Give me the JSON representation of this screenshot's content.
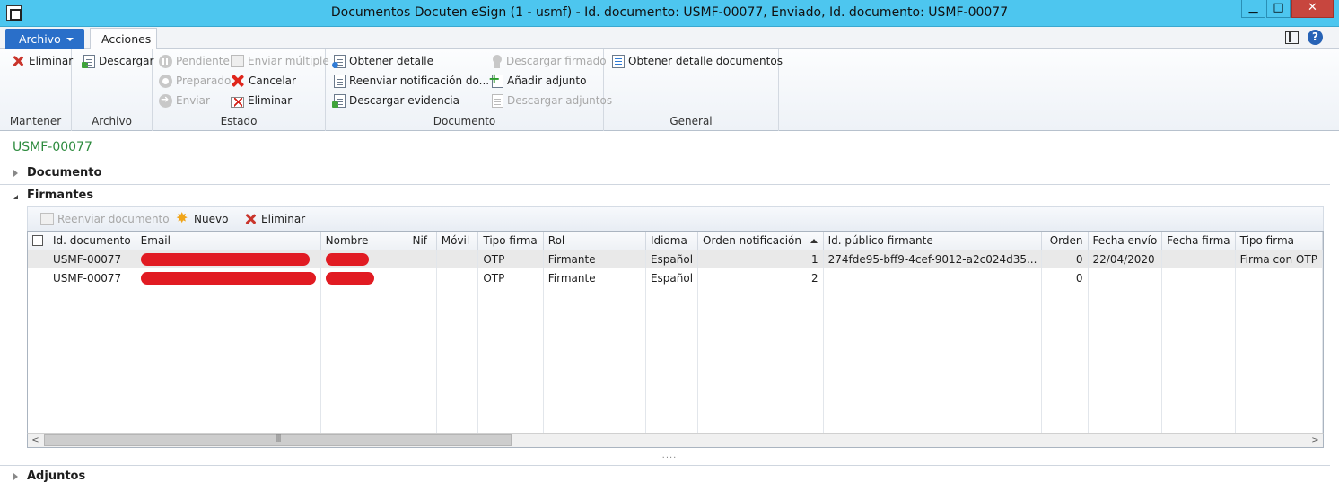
{
  "window": {
    "title": "Documentos Docuten eSign (1 - usmf) - Id. documento: USMF-00077, Enviado, Id. documento: USMF-00077",
    "minimize_glyph": "▁",
    "maximize_glyph": "□",
    "close_glyph": "✕"
  },
  "ribbon_tabs": {
    "archivo": "Archivo",
    "acciones": "Acciones",
    "help_glyph": "?"
  },
  "ribbon": {
    "mantener": {
      "label": "Mantener",
      "eliminar": "Eliminar"
    },
    "archivo": {
      "label": "Archivo",
      "descargar": "Descargar"
    },
    "estado": {
      "label": "Estado",
      "pendiente": "Pendiente",
      "preparado": "Preparado",
      "enviar": "Enviar",
      "enviar_multiple": "Enviar múltiple",
      "cancelar": "Cancelar",
      "eliminar": "Eliminar"
    },
    "documento": {
      "label": "Documento",
      "obtener_detalle": "Obtener detalle",
      "reenviar_notificacion": "Reenviar notificación do...",
      "descargar_evidencia": "Descargar evidencia",
      "descargar_firmado": "Descargar firmado",
      "anadir_adjunto": "Añadir adjunto",
      "descargar_adjuntos": "Descargar adjuntos"
    },
    "general": {
      "label": "General",
      "obtener_detalle_documentos": "Obtener detalle documentos"
    }
  },
  "record": {
    "title": "USMF-00077"
  },
  "fasttabs": {
    "documento": "Documento",
    "firmantes": "Firmantes",
    "adjuntos": "Adjuntos"
  },
  "firmantes_toolbar": {
    "reenviar_documento": "Reenviar documento",
    "nuevo": "Nuevo",
    "eliminar": "Eliminar"
  },
  "grid": {
    "columns": [
      "Id. documento",
      "Email",
      "Nombre",
      "Nif",
      "Móvil",
      "Tipo firma",
      "Rol",
      "Idioma",
      "Orden notificación",
      "Id. público firmante",
      "Orden",
      "Fecha envío",
      "Fecha firma",
      "Tipo firma"
    ],
    "rows": [
      {
        "id": "USMF-00077",
        "nif": "",
        "movil": "",
        "tipo_firma": "OTP",
        "rol": "Firmante",
        "idioma": "Español",
        "orden_notificacion": "1",
        "id_publico": "274fde95-bff9-4cef-9012-a2c024d35...",
        "orden": "0",
        "fecha_envio": "22/04/2020",
        "fecha_firma": "",
        "tipo_firma_2": "Firma con OTP"
      },
      {
        "id": "USMF-00077",
        "nif": "",
        "movil": "",
        "tipo_firma": "OTP",
        "rol": "Firmante",
        "idioma": "Español",
        "orden_notificacion": "2",
        "id_publico": "",
        "orden": "0",
        "fecha_envio": "",
        "fecha_firma": "",
        "tipo_firma_2": ""
      }
    ]
  },
  "scrollbar": {
    "left_glyph": "<",
    "right_glyph": ">"
  },
  "splitter": {
    "glyph": "...."
  },
  "colors": {
    "titlebar": "#4dc6ef",
    "archivo_tab": "#2a6fc9",
    "record_title": "#2d8b3e",
    "redaction": "#e11b22",
    "close_button": "#c7463e"
  }
}
